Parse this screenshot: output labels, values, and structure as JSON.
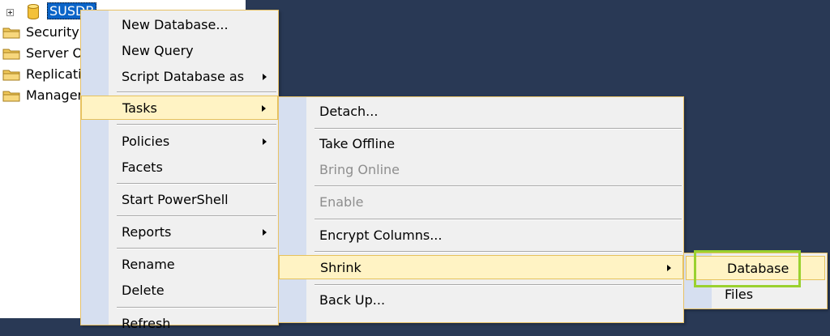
{
  "tree": {
    "db_node": {
      "label": "SUSDB"
    },
    "folders": [
      {
        "label": "Security"
      },
      {
        "label": "Server O"
      },
      {
        "label": "Replicati"
      },
      {
        "label": "Manager"
      }
    ]
  },
  "context_menu": {
    "new_database": "New Database...",
    "new_query": "New Query",
    "script_database_as": "Script Database as",
    "tasks": "Tasks",
    "policies": "Policies",
    "facets": "Facets",
    "start_powershell": "Start PowerShell",
    "reports": "Reports",
    "rename": "Rename",
    "delete": "Delete",
    "refresh_partial": "Refresh"
  },
  "tasks_menu": {
    "detach": "Detach...",
    "take_offline": "Take Offline",
    "bring_online": "Bring Online",
    "enable": "Enable",
    "encrypt_columns": "Encrypt Columns...",
    "shrink": "Shrink",
    "back_up": "Back Up..."
  },
  "shrink_menu": {
    "database": "Database",
    "files": "Files"
  },
  "colors": {
    "background": "#293955",
    "menu_bg": "#f0f0f0",
    "gutter": "#d6dff0",
    "highlight": "#fff3c4",
    "focus_box": "#9ad12f",
    "selection": "#0a64c8"
  }
}
